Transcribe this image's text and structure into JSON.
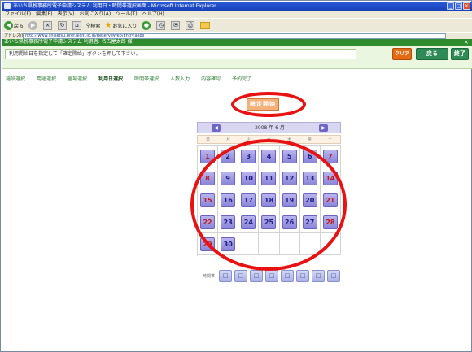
{
  "browser": {
    "title": "あいち県税事務所電子申請システム 利用日・時間帯選択画面 - Microsoft Internet Explorer",
    "menu": [
      "ファイル(F)",
      "編集(E)",
      "表示(V)",
      "お気に入り(A)",
      "ツール(T)",
      "ヘルプ(H)"
    ],
    "toolbar": {
      "back_label": "戻る",
      "search_label": "検索",
      "favorites_label": "お気に入り"
    },
    "address": {
      "label": "アドレス(D)",
      "url": "http://www.shisetsu.pref.aichi.lg.jp/ReserveWeb/Entry.aspx"
    }
  },
  "app": {
    "header": "あいち県税事務所電子申請システム  利用者: 名古屋太郎 様",
    "instruction": "利用開始日を指定して「確定開始」ボタンを押して下さい。",
    "buttons": {
      "clear": "クリア",
      "back": "戻る",
      "end": "終了"
    },
    "tabs": [
      "施設選択",
      "用途選択",
      "室場選択",
      "利用日選択",
      "時間帯選択",
      "人数入力",
      "内容確認",
      "予約完了"
    ],
    "active_tab_index": 3,
    "confirm_button": "確定開始"
  },
  "calendar": {
    "title": "2008 年 6 月",
    "prev_label": "◀",
    "next_label": "▶",
    "weekdays": [
      "日",
      "月",
      "火",
      "水",
      "木",
      "金",
      "土"
    ],
    "days": [
      [
        "1",
        "2",
        "3",
        "4",
        "5",
        "6",
        "7"
      ],
      [
        "8",
        "9",
        "10",
        "11",
        "12",
        "13",
        "14"
      ],
      [
        "15",
        "16",
        "17",
        "18",
        "19",
        "20",
        "21"
      ],
      [
        "22",
        "23",
        "24",
        "25",
        "26",
        "27",
        "28"
      ],
      [
        "29",
        "30",
        "",
        "",
        "",
        "",
        ""
      ]
    ]
  },
  "time_slots": {
    "label": "時間帯",
    "slots": [
      "□",
      "□",
      "□",
      "□",
      "□",
      "□",
      "□",
      "□"
    ]
  },
  "annotation_color": "#e81212"
}
